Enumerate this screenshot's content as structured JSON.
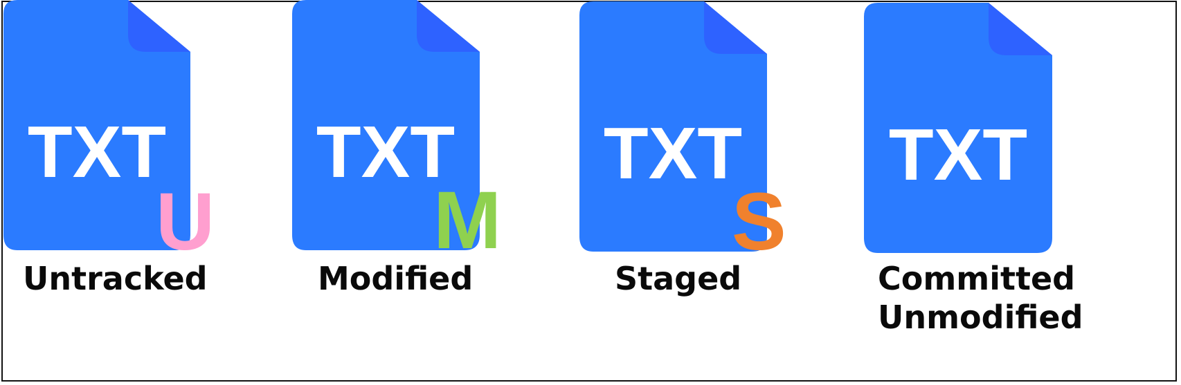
{
  "colors": {
    "doc_body": "#2b7bff",
    "doc_fold": "#2e62ff",
    "doc_text": "#ffffff",
    "border": "#111111"
  },
  "documents": [
    {
      "file_type": "TXT",
      "badge": "U",
      "badge_color": "#ff9fcf",
      "label_lines": [
        "Untracked"
      ]
    },
    {
      "file_type": "TXT",
      "badge": "M",
      "badge_color": "#8fd14f",
      "label_lines": [
        "Modified"
      ]
    },
    {
      "file_type": "TXT",
      "badge": "S",
      "badge_color": "#f0812d",
      "label_lines": [
        "Staged"
      ]
    },
    {
      "file_type": "TXT",
      "badge": "",
      "badge_color": "",
      "label_lines": [
        "Committed",
        "Unmodified"
      ]
    }
  ]
}
